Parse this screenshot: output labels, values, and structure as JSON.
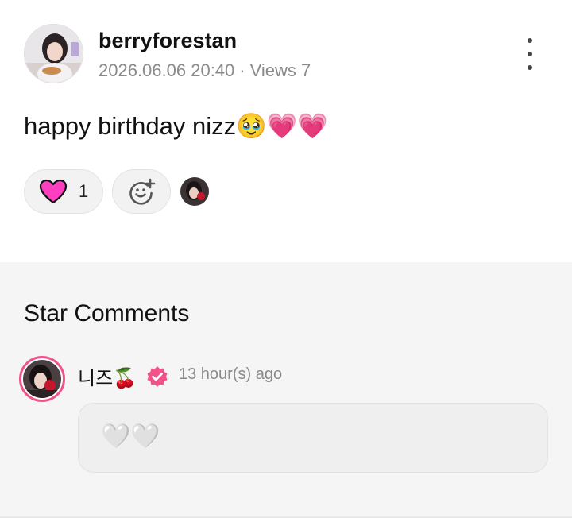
{
  "post": {
    "username": "berryforestan",
    "date": "2026.06.06 20:40",
    "separator": "·",
    "views": "Views 7",
    "text": "happy birthday nizz🥹💗💗",
    "like_count": "1"
  },
  "comments": {
    "title": "Star Comments",
    "items": [
      {
        "author": "니즈🍒",
        "time": "13 hour(s) ago",
        "text": "🤍🤍"
      }
    ]
  },
  "colors": {
    "accent_pink": "#f0538a",
    "heart_fill": "#ff3fc0",
    "muted_text": "#8a8a8a",
    "section_bg": "#f5f5f5"
  },
  "icons": {
    "more": "more-vertical-icon",
    "like": "heart-icon",
    "add_reaction": "smiley-plus-icon",
    "verified": "verified-badge-icon"
  }
}
